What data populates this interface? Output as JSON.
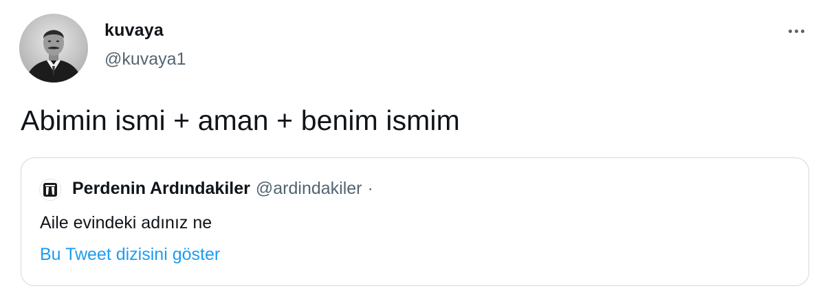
{
  "author": {
    "display_name": "kuvaya",
    "handle": "@kuvaya1",
    "avatar_icon": "portrait-photo"
  },
  "more_icon": "more-horizontal-icon",
  "tweet": {
    "text": "Abimin ismi + aman + benim ismim"
  },
  "quoted_tweet": {
    "display_name": "Perdenin Ardındakiler",
    "handle": "@ardindakiler",
    "separator": "·",
    "text": "Aile evindeki adınız ne",
    "show_thread_link": "Bu Tweet dizisini göster",
    "avatar_icon": "curtain-logo"
  },
  "colors": {
    "text_primary": "#0f1419",
    "text_secondary": "#536471",
    "link": "#1d9bf0",
    "border": "#cfd9de"
  }
}
